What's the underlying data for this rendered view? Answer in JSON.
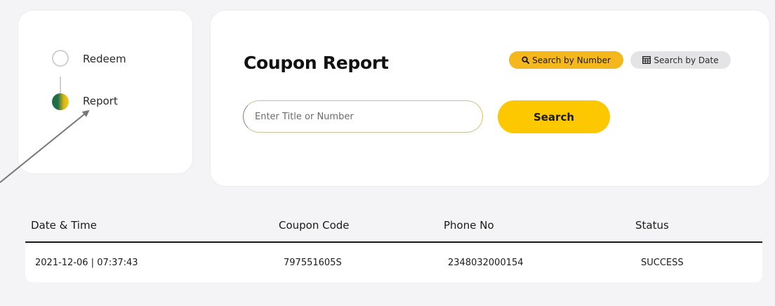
{
  "stepper": {
    "steps": [
      {
        "label": "Redeem",
        "active": false
      },
      {
        "label": "Report",
        "active": true
      }
    ]
  },
  "search_panel": {
    "title": "Coupon Report",
    "mode_by_number_label": "Search by Number",
    "mode_by_date_label": "Search by Date",
    "input_placeholder": "Enter Title or Number",
    "input_value": "",
    "search_button_label": "Search",
    "icons": {
      "by_number": "search-icon",
      "by_date": "calendar-grid-icon"
    }
  },
  "report_table": {
    "columns": [
      "Date & Time",
      "Coupon Code",
      "Phone No",
      "Status"
    ],
    "rows": [
      [
        "2021-12-06 | 07:37:43",
        "797551605S",
        "2348032000154",
        "SUCCESS"
      ]
    ]
  },
  "colors": {
    "accent_yellow": "#fdc800",
    "mode_active": "#f4b81e",
    "mode_inactive": "#e4e4e6",
    "step_green": "#1f6e4a"
  }
}
